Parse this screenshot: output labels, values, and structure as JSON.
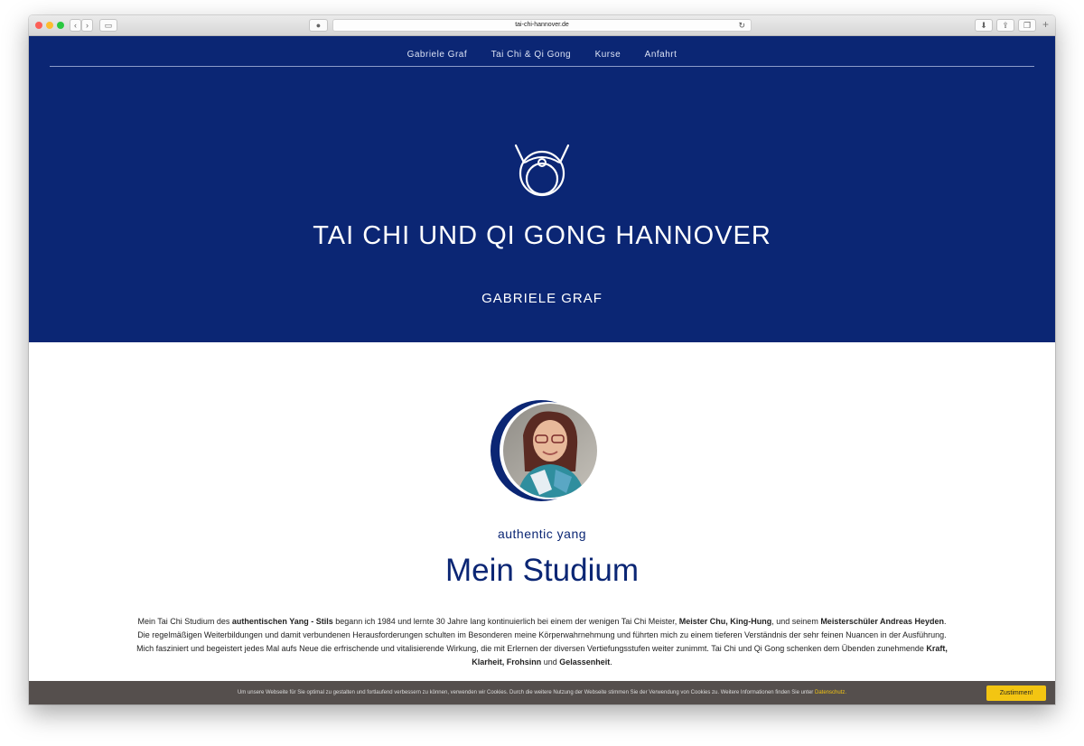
{
  "browser": {
    "url": "tai-chi-hannover.de"
  },
  "nav": {
    "items": [
      "Gabriele Graf",
      "Tai Chi & Qi Gong",
      "Kurse",
      "Anfahrt"
    ]
  },
  "hero": {
    "title": "TAI CHI UND QI GONG HANNOVER",
    "subtitle": "GABRIELE GRAF"
  },
  "section": {
    "kicker": "authentic yang",
    "heading": "Mein Studium",
    "paragraph_parts": [
      "Mein Tai Chi Studium des ",
      "authentischen Yang - Stils",
      " begann ich 1984 und lernte 30 Jahre lang kontinuierlich bei einem der wenigen Tai Chi Meister, ",
      "Meister Chu, King-Hung",
      ", und seinem ",
      "Meisterschüler Andreas Heyden",
      ". Die regelmäßigen Weiterbildungen und damit verbundenen Herausforderungen schulten im Besonderen meine Körperwahrnehmung und führten mich zu einem tieferen Verständnis der sehr feinen Nuancen in der Ausführung. Mich fasziniert und begeistert jedes Mal aufs Neue die erfrischende und vitalisierende Wirkung, die mit Erlernen der diversen Vertiefungsstufen weiter zunimmt. Tai Chi und Qi Gong schenken dem Übenden zunehmende ",
      "Kraft, Klarheit, Frohsinn",
      " und ",
      "Gelassenheit",
      "."
    ]
  },
  "cookie": {
    "text": "Um unsere Webseite für Sie optimal zu gestalten und fortlaufend verbessern zu können, verwenden wir Cookies. Durch die weitere Nutzung der Webseite stimmen Sie der Verwendung von Cookies zu. Weitere Informationen finden Sie unter ",
    "link": "Datenschutz.",
    "button": "Zustimmen!"
  },
  "colors": {
    "brand": "#0b2674",
    "cookie_bg": "#554f4d",
    "accent": "#f3c512"
  },
  "icons": [
    "lock-icon",
    "reload-icon",
    "download-icon",
    "share-icon",
    "tabs-icon",
    "sidebar-icon",
    "yang-logo-icon"
  ]
}
